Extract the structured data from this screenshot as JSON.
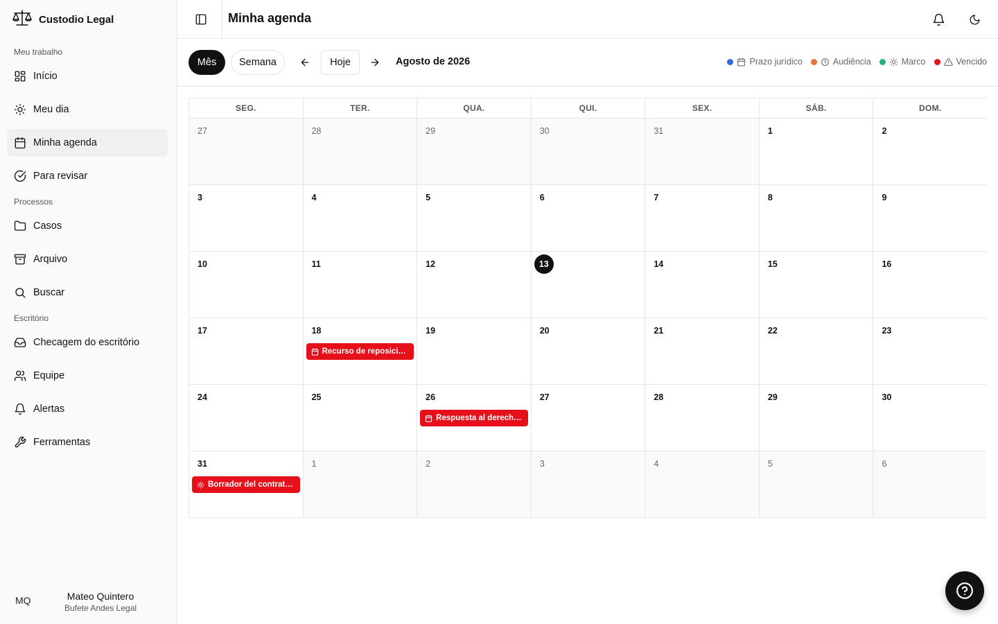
{
  "brand": {
    "name": "Custodio Legal",
    "icon": "scales-icon"
  },
  "sidebar": {
    "sections": [
      {
        "label": "Meu trabalho"
      },
      {
        "label": "Processos"
      },
      {
        "label": "Escritório"
      }
    ],
    "items": [
      {
        "label": "Início",
        "icon": "grid-icon"
      },
      {
        "label": "Meu dia",
        "icon": "sun-icon"
      },
      {
        "label": "Minha agenda",
        "icon": "calendar-icon",
        "active": true
      },
      {
        "label": "Para revisar",
        "icon": "check-circle-icon"
      },
      {
        "label": "Casos",
        "icon": "folder-icon"
      },
      {
        "label": "Arquivo",
        "icon": "archive-icon"
      },
      {
        "label": "Buscar",
        "icon": "search-icon"
      },
      {
        "label": "Checagem do escritório",
        "icon": "inbox-icon"
      },
      {
        "label": "Equipe",
        "icon": "users-icon"
      },
      {
        "label": "Alertas",
        "icon": "bell-icon"
      },
      {
        "label": "Ferramentas",
        "icon": "wrench-icon"
      }
    ]
  },
  "user": {
    "initials": "MQ",
    "name": "Mateo Quintero",
    "org": "Bufete Andes Legal"
  },
  "header": {
    "title": "Minha agenda"
  },
  "toolbar": {
    "view_month": "Mês",
    "view_week": "Semana",
    "today": "Hoje",
    "current_month": "Agosto de 2026"
  },
  "legend": [
    {
      "label": "Prazo jurídico",
      "color": "#2f6fdb",
      "icon": "calendar-icon"
    },
    {
      "label": "Audiência",
      "color": "#e8703a",
      "icon": "clock-icon"
    },
    {
      "label": "Marco",
      "color": "#27b07a",
      "icon": "sun-icon"
    },
    {
      "label": "Vencido",
      "color": "#e5101a",
      "icon": "warning-icon"
    }
  ],
  "calendar": {
    "weekdays": [
      "SEG.",
      "TER.",
      "QUA.",
      "QUI.",
      "SEX.",
      "SÁB.",
      "DOM."
    ],
    "today": "13",
    "weeks": [
      [
        "27",
        "28",
        "29",
        "30",
        "31",
        "1",
        "2"
      ],
      [
        "3",
        "4",
        "5",
        "6",
        "7",
        "8",
        "9"
      ],
      [
        "10",
        "11",
        "12",
        "13",
        "14",
        "15",
        "16"
      ],
      [
        "17",
        "18",
        "19",
        "20",
        "21",
        "22",
        "23"
      ],
      [
        "24",
        "25",
        "26",
        "27",
        "28",
        "29",
        "30"
      ],
      [
        "31",
        "1",
        "2",
        "3",
        "4",
        "5",
        "6"
      ]
    ],
    "events": [
      {
        "day": "18",
        "week": 3,
        "weekday": 1,
        "label": "Recurso de reposició...",
        "icon": "calendar-icon",
        "color": "#e5101a"
      },
      {
        "day": "26",
        "week": 4,
        "weekday": 2,
        "label": "Respuesta al derecho...",
        "icon": "calendar-icon",
        "color": "#e5101a"
      },
      {
        "day": "31",
        "week": 5,
        "weekday": 0,
        "label": "Borrador del contrato...",
        "icon": "sun-icon",
        "color": "#e5101a"
      }
    ]
  },
  "help": {
    "icon": "help-circle-icon"
  }
}
